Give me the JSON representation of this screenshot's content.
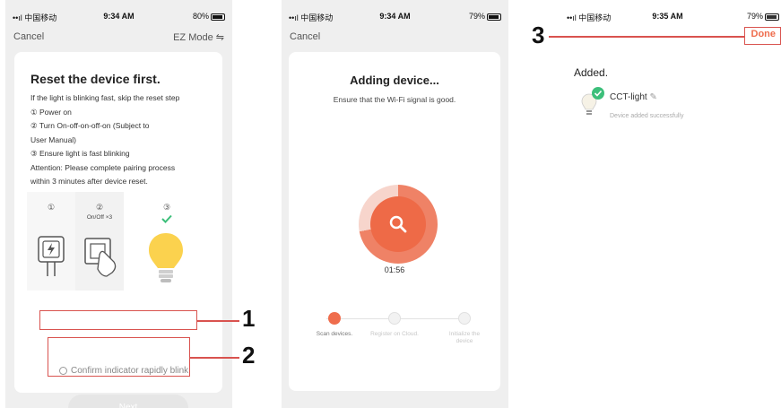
{
  "screen1": {
    "status": {
      "carrier": "••ıl 中国移动",
      "time": "9:34 AM",
      "battery": "80%"
    },
    "nav": {
      "cancel": "Cancel",
      "mode": "EZ Mode"
    },
    "title": "Reset the device first.",
    "instructions": [
      "If the light is blinking fast, skip the reset step",
      "① Power on",
      "② Turn On-off-on-off-on (Subject to",
      "User Manual)",
      "③ Ensure light is fast blinking",
      "Attention: Please complete pairing process",
      "within 3 minutes after device reset."
    ],
    "illustration": {
      "step1": "①",
      "step2": "②",
      "step2_sub": "On/Off ×3",
      "step3": "③"
    },
    "confirm_label": "Confirm indicator rapidly blink",
    "next_label": "Next",
    "confirm_checked": false
  },
  "screen2": {
    "status": {
      "carrier": "••ıl 中国移动",
      "time": "9:34 AM",
      "battery": "79%"
    },
    "nav": {
      "cancel": "Cancel"
    },
    "title": "Adding device...",
    "subtitle": "Ensure that the Wi-Fi signal is good.",
    "timer": "01:56",
    "steps": [
      {
        "label": "Scan devices.",
        "state": "active"
      },
      {
        "label": "Register on Cloud.",
        "state": "idle"
      },
      {
        "label": "Initialize the device",
        "state": "idle"
      }
    ]
  },
  "screen3": {
    "status": {
      "carrier": "••ıl 中国移动",
      "time": "9:35 AM",
      "battery": "79%"
    },
    "done_label": "Done",
    "added_title": "Added.",
    "device_name": "CCT-light",
    "device_status": "Device added successfully"
  },
  "callouts": {
    "c1": "1",
    "c2": "2",
    "c3": "3"
  },
  "colors": {
    "accent": "#ef6d4d",
    "highlight": "#d9534f",
    "success": "#3cbf7a",
    "bulb": "#fbd24e"
  }
}
